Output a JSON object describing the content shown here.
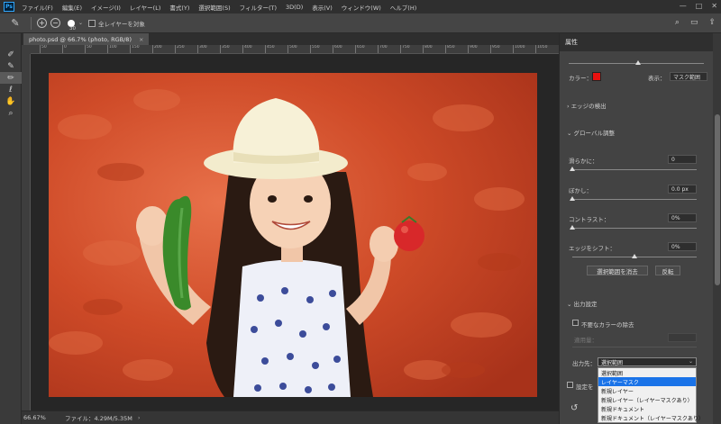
{
  "menubar": {
    "app_icon": "Ps",
    "items": [
      "ファイル(F)",
      "編集(E)",
      "イメージ(I)",
      "レイヤー(L)",
      "書式(Y)",
      "選択範囲(S)",
      "フィルター(T)",
      "3D(D)",
      "表示(V)",
      "ウィンドウ(W)",
      "ヘルプ(H)"
    ],
    "window_controls": [
      "—",
      "□",
      "✕"
    ]
  },
  "options_bar": {
    "brush_size": "30",
    "sample_all_layers_label": "全レイヤーを対象",
    "sample_all_layers_checked": false
  },
  "document": {
    "tab_title": "photo.psd @ 66.7% (photo, RGB/8)",
    "close_glyph": "×",
    "ruler_ticks": [
      "50",
      "0",
      "50",
      "100",
      "150",
      "200",
      "250",
      "300",
      "350",
      "400",
      "450",
      "500",
      "550",
      "600",
      "650",
      "700",
      "750",
      "800",
      "850",
      "900",
      "950",
      "1000",
      "1050"
    ]
  },
  "status_bar": {
    "zoom": "66.67%",
    "file_info": "ファイル：4.29M/5.35M",
    "arrow": "›"
  },
  "properties_panel": {
    "tab_label": "属性",
    "color_label": "カラー：",
    "color_value": "#e8110f",
    "view_label": "表示：",
    "view_value": "マスク範囲",
    "edge_detection_label": "エッジの検出",
    "global_refinement_label": "グローバル調整",
    "smooth_label": "滑らかに：",
    "smooth_value": "0",
    "feather_label": "ぼかし：",
    "feather_value": "0.0 px",
    "contrast_label": "コントラスト：",
    "contrast_value": "0%",
    "shift_edge_label": "エッジをシフト：",
    "shift_edge_value": "0%",
    "clear_selection_button": "選択範囲を消去",
    "invert_button": "反転",
    "output_settings_label": "出力設定",
    "decontaminate_label": "不要なカラーの除去",
    "decontaminate_checked": false,
    "amount_label": "適用量：",
    "output_to_label": "出力先：",
    "output_to_value": "選択範囲",
    "remember_label": "設定を",
    "output_options": [
      "選択範囲",
      "レイヤーマスク",
      "新規レイヤー",
      "新規レイヤー（レイヤーマスクあり）",
      "新規ドキュメント",
      "新規ドキュメント（レイヤーマスクあり）"
    ],
    "active_option_index": 1
  }
}
